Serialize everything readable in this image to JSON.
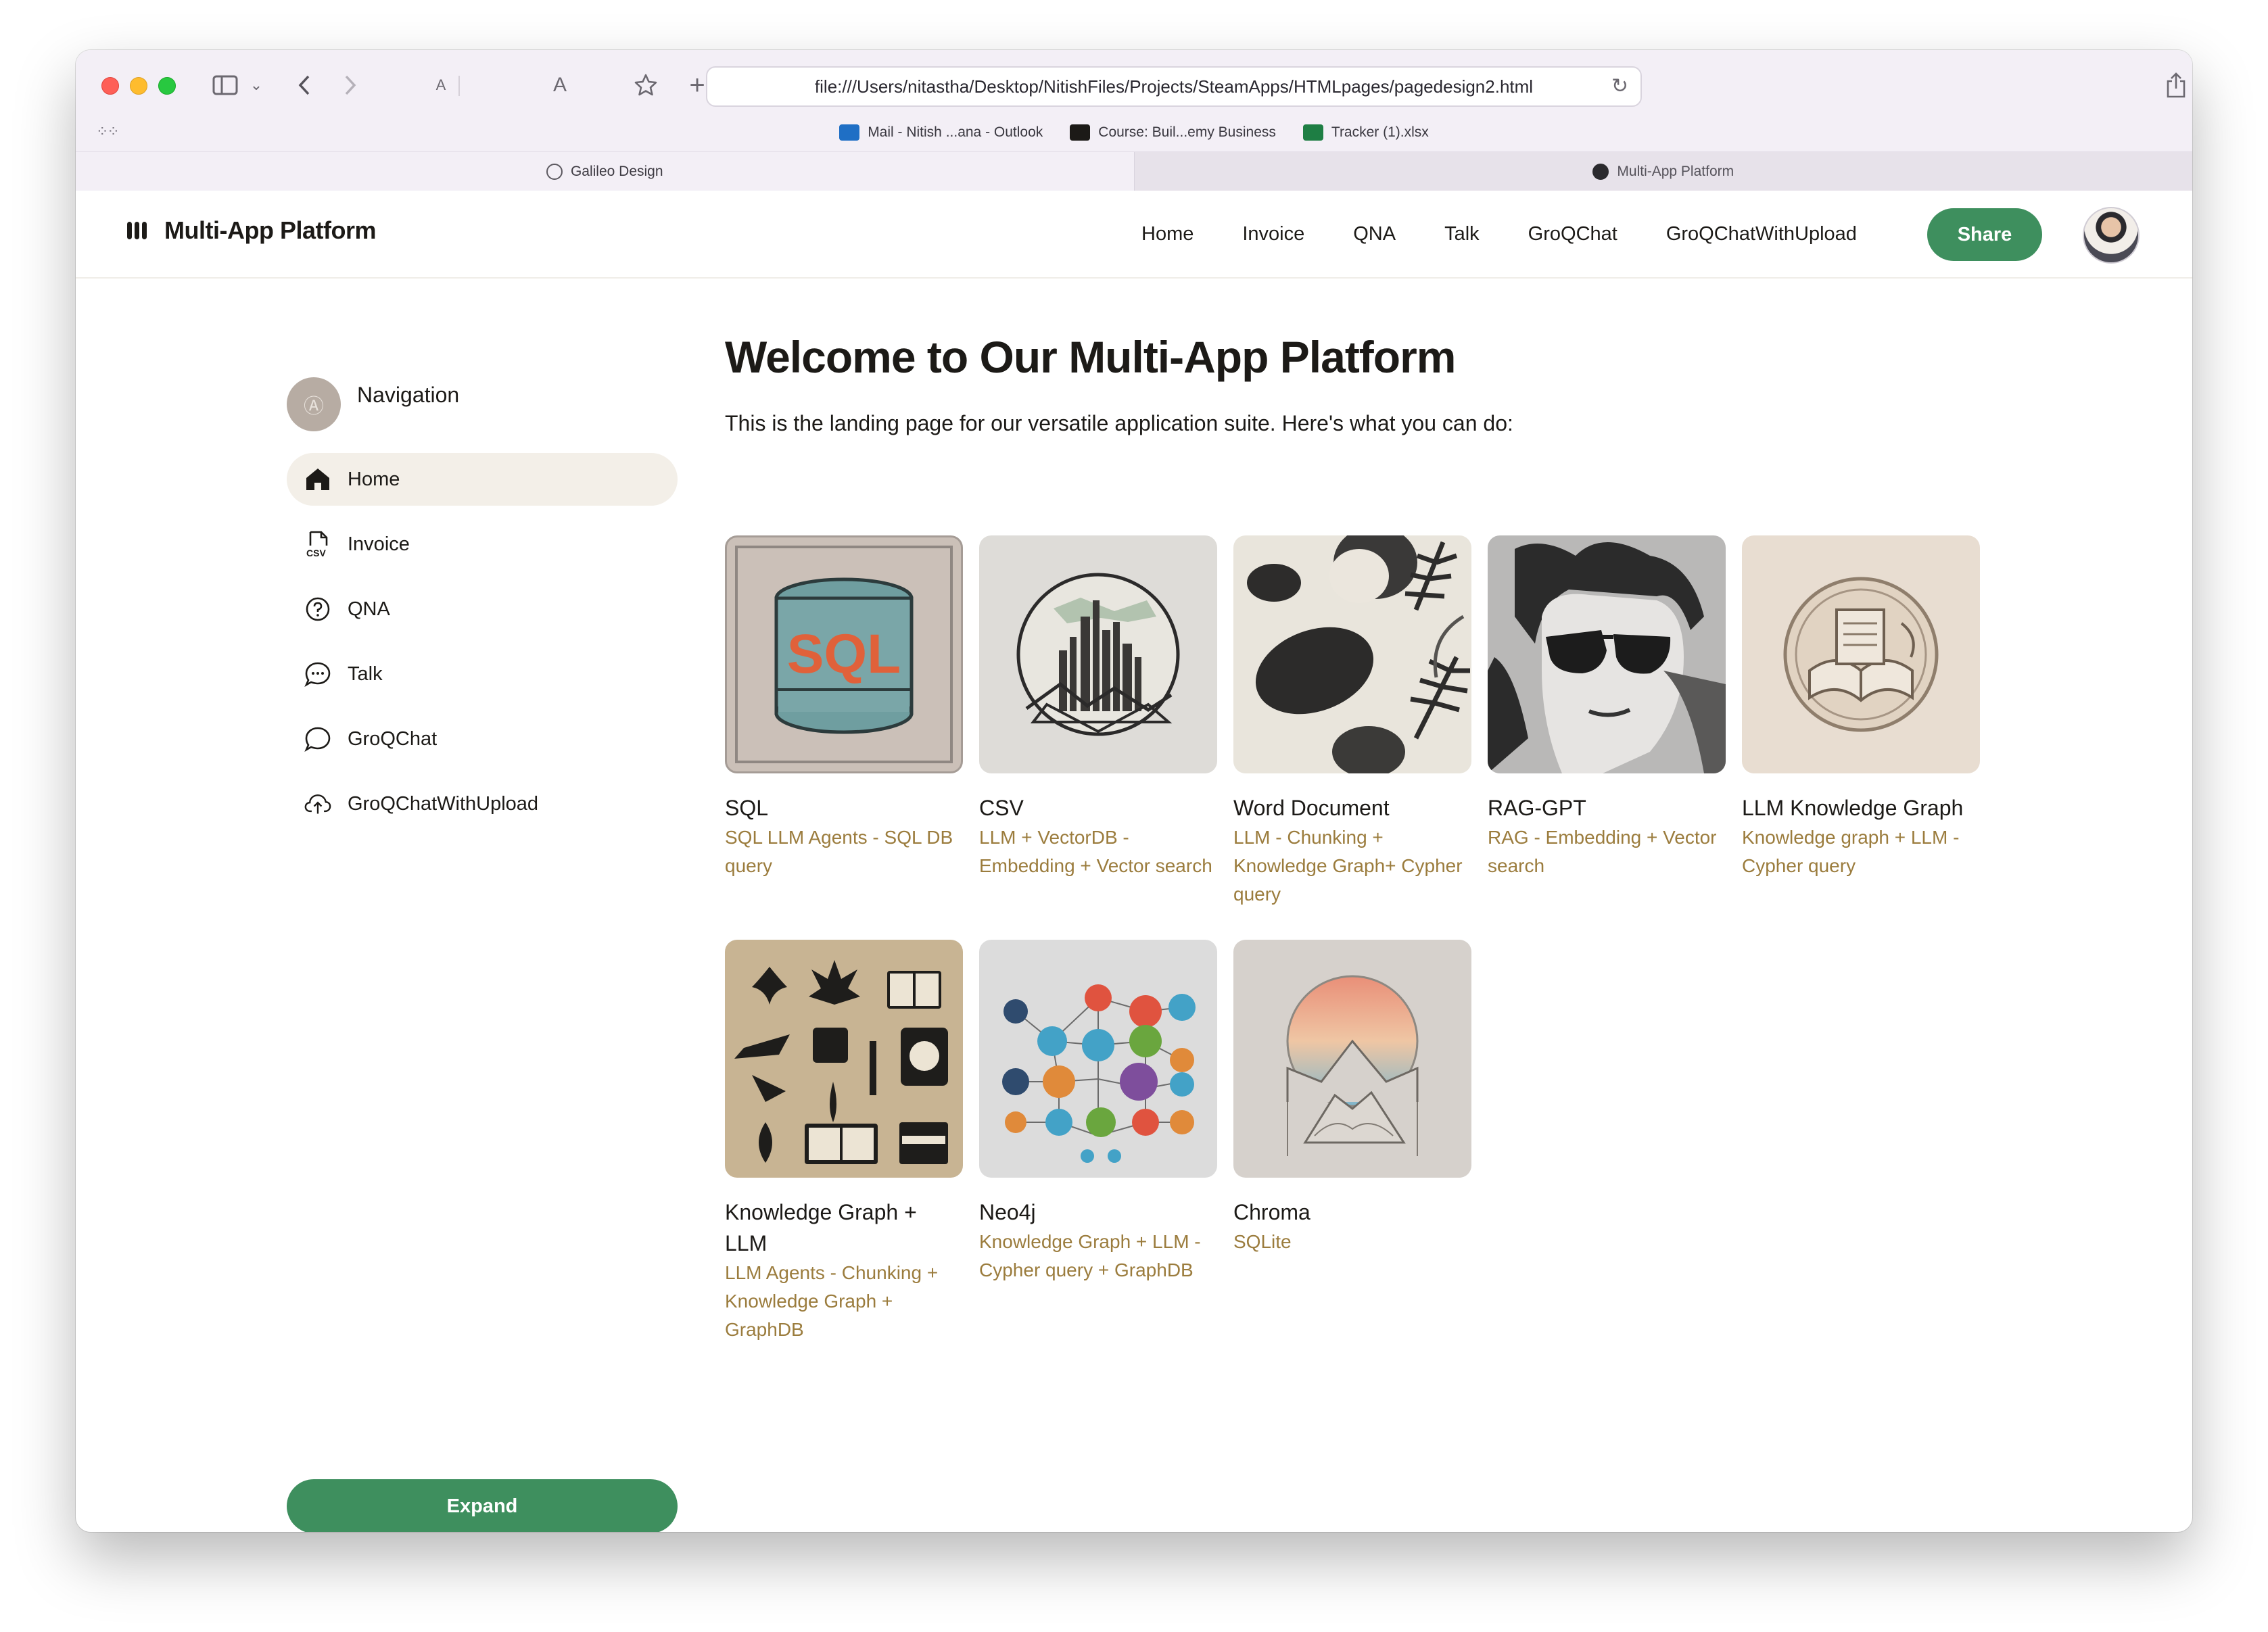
{
  "browser": {
    "url": "file:///Users/nitastha/Desktop/NitishFiles/Projects/SteamApps/HTMLpages/pagedesign2.html",
    "text_small": "A",
    "text_large": "A",
    "bookmarks": [
      {
        "label": "Mail - Nitish ...ana - Outlook",
        "color": "#1f6fc5"
      },
      {
        "label": "Course: Buil...emy Business",
        "color": "#1c1a17"
      },
      {
        "label": "Tracker (1).xlsx",
        "color": "#1e7e44"
      }
    ],
    "tabs": [
      {
        "label": "Galileo Design"
      },
      {
        "label": "Multi-App Platform"
      }
    ]
  },
  "header": {
    "brand": "Multi-App Platform",
    "nav": [
      "Home",
      "Invoice",
      "QNA",
      "Talk",
      "GroQChat",
      "GroQChatWithUpload"
    ],
    "share_label": "Share"
  },
  "sidebar": {
    "title": "Navigation",
    "items": [
      {
        "label": "Home",
        "icon": "home-icon",
        "active": true
      },
      {
        "label": "Invoice",
        "icon": "csv-file-icon",
        "active": false
      },
      {
        "label": "QNA",
        "icon": "question-circle-icon",
        "active": false
      },
      {
        "label": "Talk",
        "icon": "chat-dots-icon",
        "active": false
      },
      {
        "label": "GroQChat",
        "icon": "chat-bubble-icon",
        "active": false
      },
      {
        "label": "GroQChatWithUpload",
        "icon": "cloud-upload-icon",
        "active": false
      }
    ],
    "expand_label": "Expand"
  },
  "main": {
    "title": "Welcome to Our Multi-App Platform",
    "subtitle": "This is the landing page for our versatile application suite. Here's what you can do:",
    "cards": [
      {
        "title": "SQL",
        "desc": "SQL LLM Agents - SQL DB query",
        "image": "database-sql-illustration"
      },
      {
        "title": "CSV",
        "desc": "LLM + VectorDB - Embedding + Vector search",
        "image": "city-skyline-illustration"
      },
      {
        "title": "Word Document",
        "desc": "LLM - Chunking + Knowledge Graph+ Cypher query",
        "image": "leaves-stones-illustration"
      },
      {
        "title": "RAG-GPT",
        "desc": "RAG - Embedding + Vector search",
        "image": "sunglasses-portrait-illustration"
      },
      {
        "title": "LLM Knowledge Graph",
        "desc": "Knowledge graph + LLM - Cypher query",
        "image": "book-medallion-illustration"
      },
      {
        "title": "Knowledge Graph + LLM",
        "desc": "LLM Agents - Chunking + Knowledge Graph + GraphDB",
        "image": "icon-set-illustration"
      },
      {
        "title": "Neo4j",
        "desc": "Knowledge Graph + LLM - Cypher query + GraphDB",
        "image": "network-graph-illustration"
      },
      {
        "title": "Chroma",
        "desc": "SQLite",
        "image": "gradient-sun-mountain-illustration"
      }
    ]
  },
  "colors": {
    "accent_green": "#3e8f5e",
    "description_gold": "#9b7c3d",
    "active_item_bg": "#f3efe8"
  }
}
